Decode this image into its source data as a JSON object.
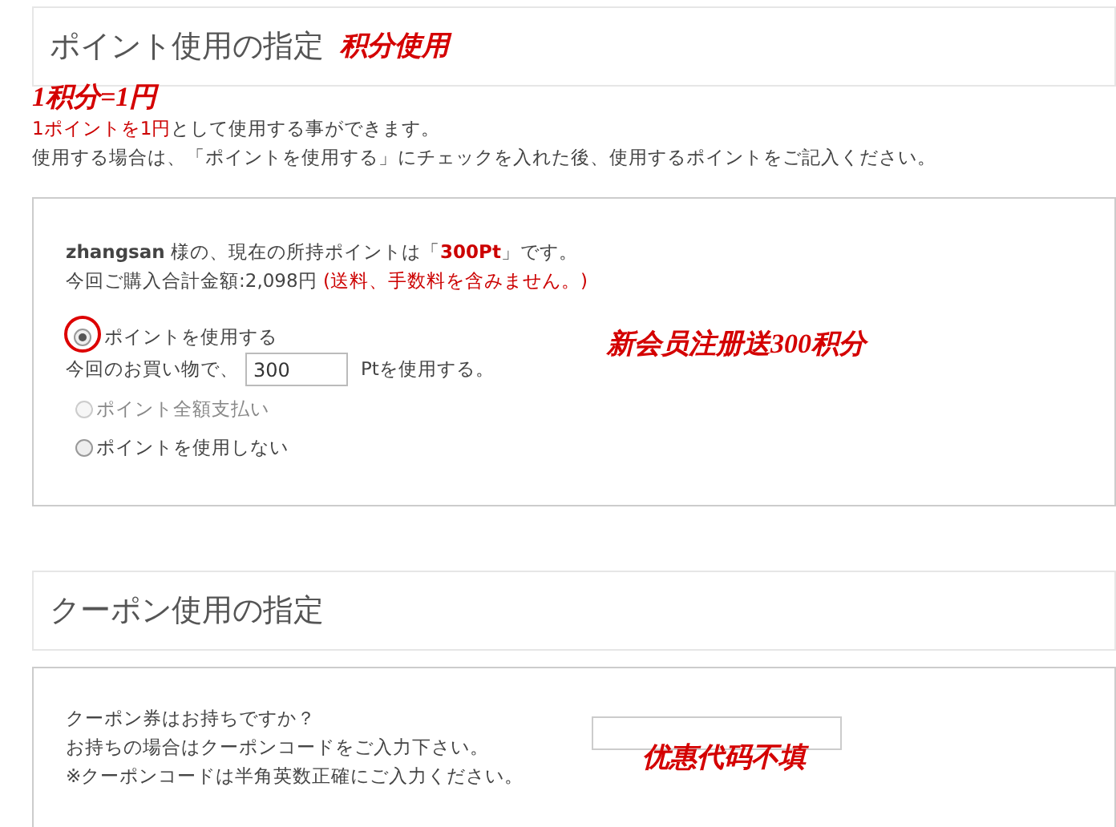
{
  "points_section": {
    "title": "ポイント使用の指定",
    "title_annotation": "积分使用",
    "rate_annotation": "1积分=1円",
    "notes": [
      [
        {
          "text": "1ポイントを1円",
          "kind": "red"
        },
        {
          "text": "として使用する事ができます。",
          "kind": "plain"
        }
      ],
      [
        {
          "text": "使用する場合は、「ポイントを使用する」にチェックを入れた後、使用するポイントをご記入ください。",
          "kind": "plain"
        }
      ]
    ],
    "balance_lines": [
      [
        {
          "text": "zhangsan",
          "kind": "bold"
        },
        {
          "text": " 様の、現在の所持ポイントは「",
          "kind": "plain"
        },
        {
          "text": "300Pt",
          "kind": "emphasis"
        },
        {
          "text": "」です。",
          "kind": "plain"
        }
      ],
      [
        {
          "text": "今回ご購入合計金額:",
          "kind": "plain"
        },
        {
          "text": "2,098円",
          "kind": "plain"
        },
        {
          "text": " (送料、手数料を含みません。)",
          "kind": "red"
        }
      ]
    ],
    "options": [
      {
        "label": "ポイントを使用する",
        "selected": true,
        "disabled": false,
        "circled": true,
        "amount": {
          "prefix": "今回のお買い物で、",
          "value": "300",
          "suffix": "Ptを使用する。"
        }
      },
      {
        "label": "ポイント全額支払い",
        "selected": false,
        "disabled": true,
        "circled": false
      },
      {
        "label": "ポイントを使用しない",
        "selected": false,
        "disabled": false,
        "circled": false
      }
    ],
    "options_annotation": "新会员注册送300积分"
  },
  "coupon_section": {
    "title": "クーポン使用の指定",
    "lines": [
      "クーポン券はお持ちですか？",
      "お持ちの場合はクーポンコードをご入力下さい。",
      "※クーポンコードは半角英数正確にご入力ください。"
    ],
    "annotation": "优惠代码不填"
  }
}
